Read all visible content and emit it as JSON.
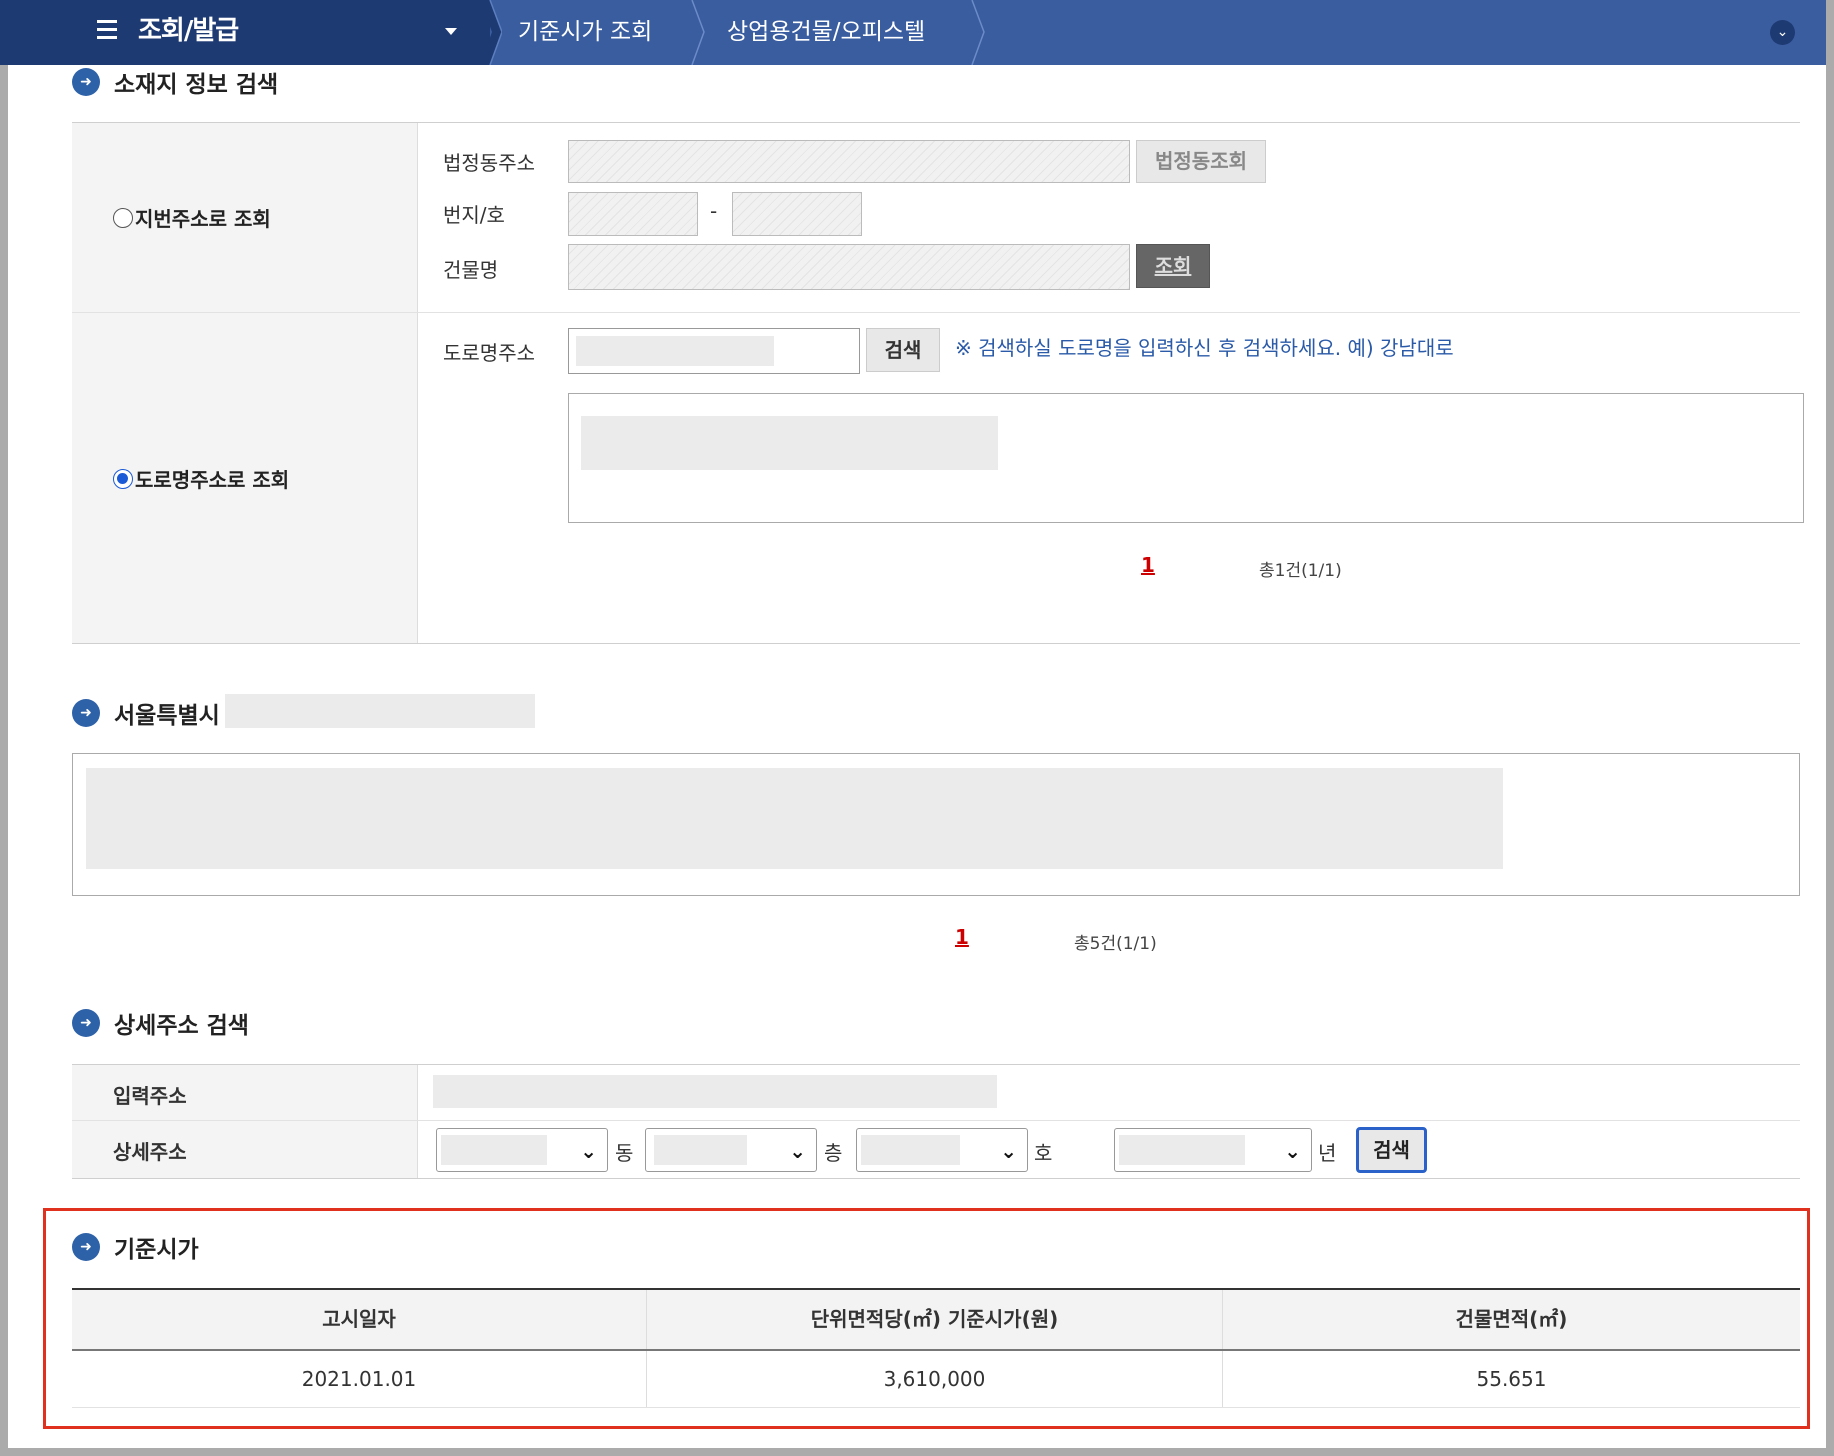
{
  "nav": {
    "menu_title": "조회/발급",
    "crumb1": "기준시가 조회",
    "crumb2": "상업용건물/오피스텔"
  },
  "location_search": {
    "title": "소재지 정보 검색",
    "lot_mode_label": "지번주소로 조회",
    "lot_fields": {
      "legal_dong_label": "법정동주소",
      "legal_dong_button": "법정동조회",
      "lot_number_label": "번지/호",
      "dash": "-",
      "building_name_label": "건물명",
      "lookup_button": "조회"
    },
    "road_mode_label": "도로명주소로 조회",
    "road_fields": {
      "road_label": "도로명주소",
      "search_button": "검색",
      "hint": "※ 검색하실 도로명을 입력하신 후 검색하세요. 예) 강남대로"
    },
    "pagination": {
      "page": "1",
      "total": "총1건(1/1)"
    }
  },
  "region": {
    "title": "서울특별시",
    "pagination": {
      "page": "1",
      "total": "총5건(1/1)"
    }
  },
  "detail_search": {
    "title": "상세주소 검색",
    "input_address_label": "입력주소",
    "detail_address_label": "상세주소",
    "unit_dong": "동",
    "unit_floor": "층",
    "unit_ho": "호",
    "unit_year": "년",
    "search_button": "검색"
  },
  "standard_price": {
    "title": "기준시가",
    "columns": [
      "고시일자",
      "단위면적당(㎡) 기준시가(원)",
      "건물면적(㎡)"
    ],
    "rows": [
      [
        "2021.01.01",
        "3,610,000",
        "55.651"
      ]
    ]
  },
  "colors": {
    "nav_dark": "#1e3a73",
    "nav_light": "#3a5da0",
    "accent_blue": "#2e62a8",
    "highlight_red": "#e0301e",
    "page_red": "#cc0000"
  }
}
